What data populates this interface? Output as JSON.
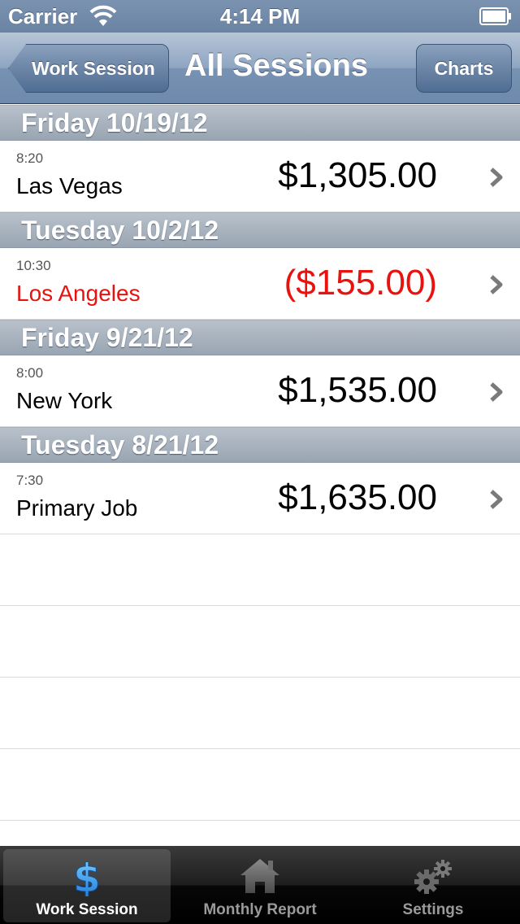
{
  "status_bar": {
    "carrier": "Carrier",
    "time": "4:14 PM"
  },
  "nav_bar": {
    "back_label": "Work Session",
    "title": "All Sessions",
    "right_button_label": "Charts"
  },
  "sections": [
    {
      "header": "Friday 10/19/12",
      "rows": [
        {
          "time": "8:20",
          "location": "Las Vegas",
          "amount": "$1,305.00",
          "negative": false
        }
      ]
    },
    {
      "header": "Tuesday 10/2/12",
      "rows": [
        {
          "time": "10:30",
          "location": "Los Angeles",
          "amount": "($155.00)",
          "negative": true
        }
      ]
    },
    {
      "header": "Friday 9/21/12",
      "rows": [
        {
          "time": "8:00",
          "location": "New York",
          "amount": "$1,535.00",
          "negative": false
        }
      ]
    },
    {
      "header": "Tuesday 8/21/12",
      "rows": [
        {
          "time": "7:30",
          "location": "Primary Job",
          "amount": "$1,635.00",
          "negative": false
        }
      ]
    }
  ],
  "tab_bar": {
    "tabs": [
      {
        "label": "Work Session",
        "icon": "dollar-icon",
        "selected": true
      },
      {
        "label": "Monthly Report",
        "icon": "house-icon",
        "selected": false
      },
      {
        "label": "Settings",
        "icon": "gears-icon",
        "selected": false
      }
    ]
  },
  "colors": {
    "negative": "#e8120e",
    "nav_bar": "#7892b3",
    "section_header": "#a7b2bd",
    "selected_icon": "#3aa0f0"
  }
}
